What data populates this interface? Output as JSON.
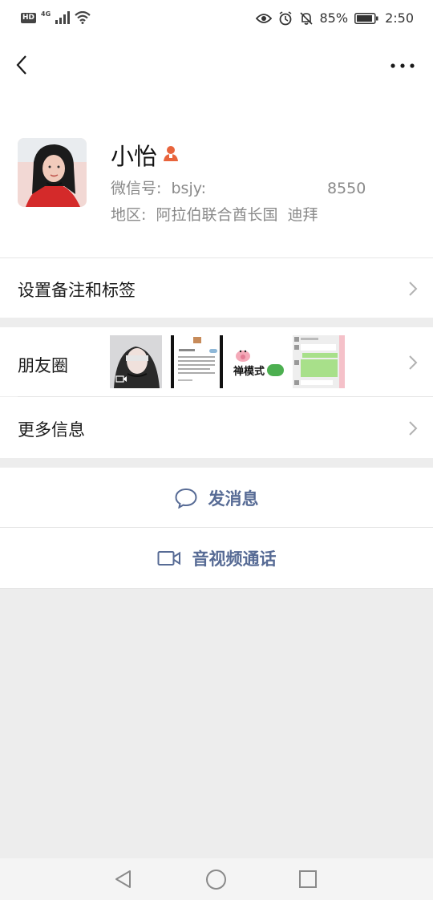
{
  "status_bar": {
    "hd": "HD",
    "network": "4G",
    "battery": "85%",
    "time": "2:50"
  },
  "profile": {
    "name": "小怡",
    "wechat_id": "微信号:  bsjy:                         8550",
    "region": "地区:  阿拉伯联合酋长国  迪拜"
  },
  "rows": {
    "remark_tags": "设置备注和标签",
    "moments": "朋友圈",
    "more_info": "更多信息"
  },
  "moments_thumbs": {
    "thumb3_text": "禅模式"
  },
  "actions": {
    "message": "发消息",
    "call": "音视频通话"
  },
  "colors": {
    "link": "#576b95",
    "background": "#ededed",
    "gender_icon": "#e8643c"
  }
}
